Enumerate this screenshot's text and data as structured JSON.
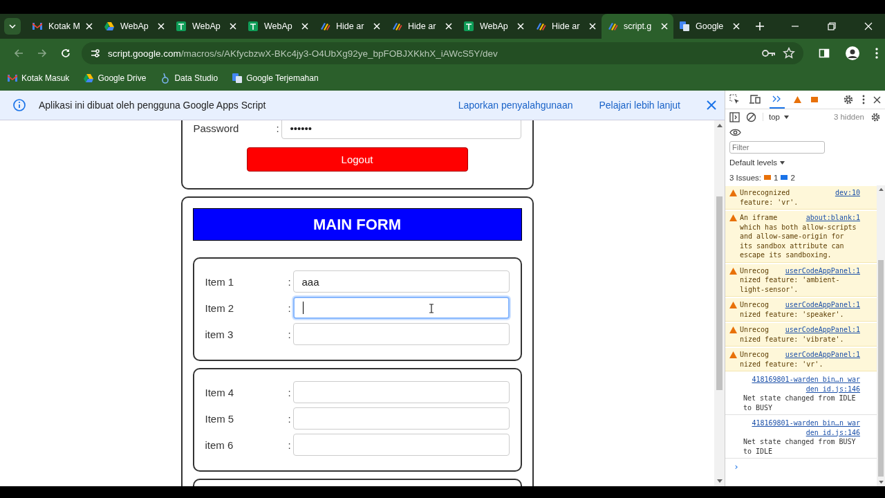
{
  "tabs": [
    {
      "kind": "gmail",
      "title": "Kotak M",
      "selected": false
    },
    {
      "kind": "drive",
      "title": "WebAp",
      "selected": false
    },
    {
      "kind": "sheets",
      "title": "WebAp",
      "selected": false
    },
    {
      "kind": "sheets",
      "title": "WebAp",
      "selected": false
    },
    {
      "kind": "script",
      "title": "Hide ar",
      "selected": false
    },
    {
      "kind": "script",
      "title": "Hide ar",
      "selected": false
    },
    {
      "kind": "sheets",
      "title": "WebAp",
      "selected": false
    },
    {
      "kind": "script",
      "title": "Hide ar",
      "selected": false
    },
    {
      "kind": "script",
      "title": "script.g",
      "selected": true
    },
    {
      "kind": "translate",
      "title": "Google",
      "selected": false
    }
  ],
  "address": {
    "host": "script.google.com",
    "path": "/macros/s/AKfycbzwX-BKc4jy3-O4UbXg92ye_bpFOBJXKkhX_iAWcS5Y/dev"
  },
  "bookmarks": [
    {
      "kind": "gmail",
      "label": "Kotak Masuk"
    },
    {
      "kind": "drive",
      "label": "Google Drive"
    },
    {
      "kind": "studio",
      "label": "Data Studio"
    },
    {
      "kind": "translate",
      "label": "Google Terjemahan"
    }
  ],
  "info_bar": {
    "message": "Aplikasi ini dibuat oleh pengguna Google Apps Script",
    "links": [
      "Laporkan penyalahgunaan",
      "Pelajari lebih lanjut"
    ]
  },
  "login": {
    "label": "Password",
    "colon": ":",
    "value": "••••••",
    "button": "Logout"
  },
  "form": {
    "title": "MAIN FORM",
    "groups": [
      [
        {
          "label": "Item 1",
          "colon": ":",
          "value": "aaa",
          "focused": false
        },
        {
          "label": "Item 2",
          "colon": ":",
          "focused": true
        },
        {
          "label": "item 3",
          "colon": ":",
          "focused": false
        }
      ],
      [
        {
          "label": "Item 4",
          "colon": ":",
          "focused": false
        },
        {
          "label": "Item 5",
          "colon": ":",
          "focused": false
        },
        {
          "label": "item 6",
          "colon": ":",
          "focused": false
        }
      ]
    ]
  },
  "devtools": {
    "context": "top",
    "hidden": "3 hidden",
    "filter_placeholder": "Filter",
    "levels": "Default levels",
    "issues": {
      "label": "3 Issues:",
      "warnings": "1",
      "infos": "2"
    },
    "messages": [
      {
        "kind": "warning",
        "lead": "Unrecognized",
        "link": "dev:10",
        "text": "feature: 'vr'."
      },
      {
        "kind": "warning",
        "lead": "An iframe",
        "link": "about:blank:1",
        "text": "which has both allow-scripts and allow-same-origin for its sandbox attribute can escape its sandboxing."
      },
      {
        "kind": "warning",
        "lead": "Unrecog",
        "link": "userCodeAppPanel:1",
        "text": "nized feature: 'ambient-light-sensor'."
      },
      {
        "kind": "warning",
        "lead": "Unrecog",
        "link": "userCodeAppPanel:1",
        "text": "nized feature: 'speaker'."
      },
      {
        "kind": "warning",
        "lead": "Unrecog",
        "link": "userCodeAppPanel:1",
        "text": "nized feature: 'vibrate'."
      },
      {
        "kind": "warning",
        "lead": "Unrecog",
        "link": "userCodeAppPanel:1",
        "text": "nized feature: 'vr'."
      },
      {
        "kind": "log",
        "link_lines": [
          "418169801-warden bin…n war",
          "den  id.js:146"
        ],
        "text": "Net state changed from IDLE to BUSY"
      },
      {
        "kind": "log",
        "link_lines": [
          "418169801-warden bin…n war",
          "den  id.js:146"
        ],
        "text": "Net state changed from BUSY to IDLE"
      }
    ],
    "prompt": "›"
  }
}
